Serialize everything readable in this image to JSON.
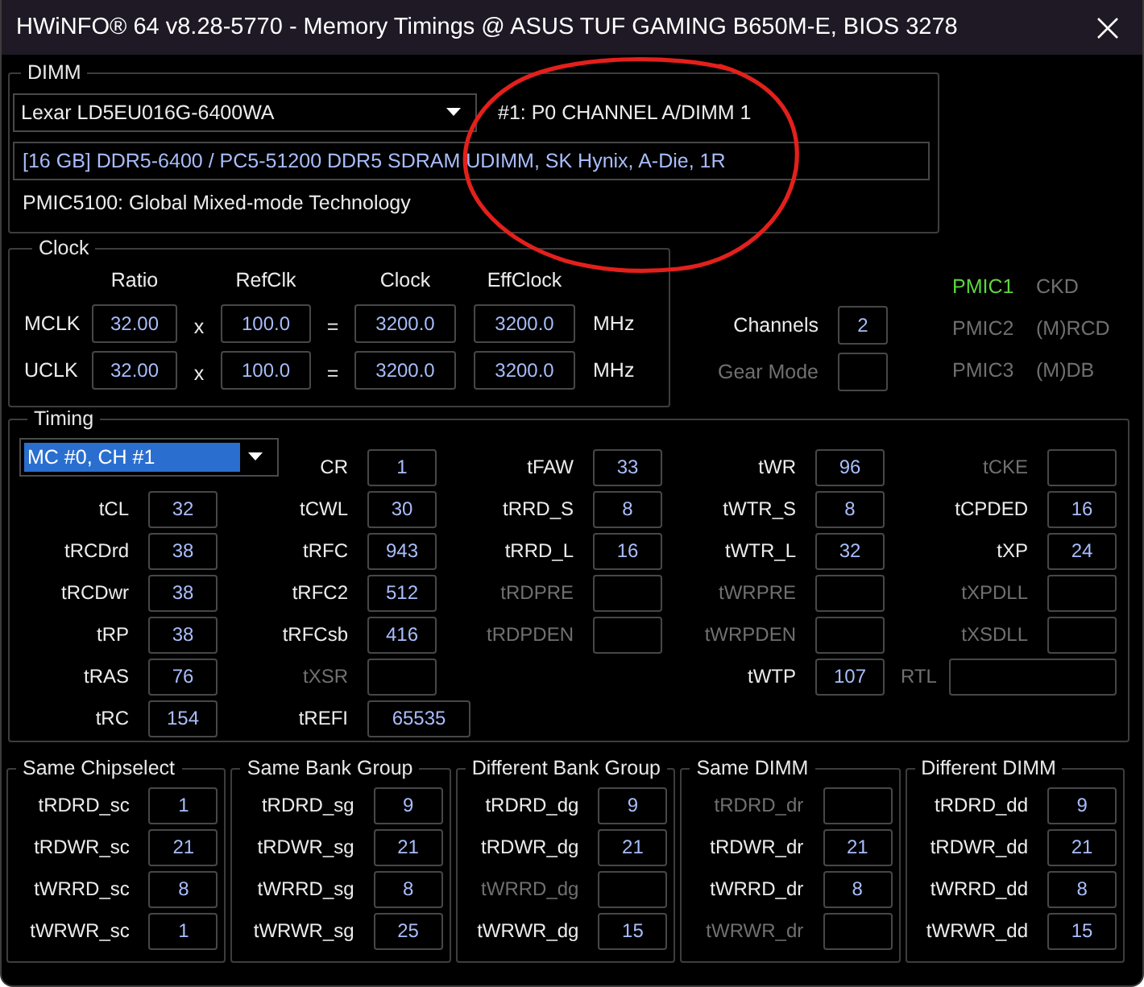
{
  "window": {
    "title": "HWiNFO® 64 v8.28-5770 - Memory Timings @ ASUS TUF GAMING B650M-E, BIOS 3278"
  },
  "dimm": {
    "title": "DIMM",
    "module_select": {
      "value": "Lexar LD5EU016G-6400WA"
    },
    "slot": "#1: P0 CHANNEL A/DIMM 1",
    "description": "[16 GB] DDR5-6400 / PC5-51200 DDR5 SDRAM UDIMM, SK Hynix, A-Die, 1R",
    "pmic": "PMIC5100: Global Mixed-mode Technology"
  },
  "clock": {
    "title": "Clock",
    "columns": [
      "Ratio",
      "RefClk",
      "Clock",
      "EffClock"
    ],
    "rows": [
      {
        "label": "MCLK",
        "ratio": "32.00",
        "times": "x",
        "refclk": "100.0",
        "equals": "=",
        "clock": "3200.0",
        "effclock": "3200.0",
        "unit": "MHz"
      },
      {
        "label": "UCLK",
        "ratio": "32.00",
        "times": "x",
        "refclk": "100.0",
        "equals": "=",
        "clock": "3200.0",
        "effclock": "3200.0",
        "unit": "MHz"
      }
    ]
  },
  "settings": [
    {
      "label": "Channels",
      "value": "2",
      "disabled": false
    },
    {
      "label": "Gear Mode",
      "disabled": true
    }
  ],
  "pmics": [
    {
      "name": "PMIC1",
      "role": "CKD",
      "active": true
    },
    {
      "name": "PMIC2",
      "role": "(M)RCD",
      "active": false
    },
    {
      "name": "PMIC3",
      "role": "(M)DB",
      "active": false
    }
  ],
  "timing": {
    "title": "Timing",
    "channel_select": {
      "value": "MC #0, CH #1",
      "highlighted": true
    },
    "columns": [
      [
        {
          "label": "tCL",
          "value": "32",
          "disabled": false,
          "kind": "standard"
        },
        {
          "label": "tRCDrd",
          "value": "38",
          "disabled": false,
          "kind": "standard"
        },
        {
          "label": "tRCDwr",
          "value": "38",
          "disabled": false,
          "kind": "standard"
        },
        {
          "label": "tRP",
          "value": "38",
          "disabled": false,
          "kind": "standard"
        },
        {
          "label": "tRAS",
          "value": "76",
          "disabled": false,
          "kind": "standard"
        },
        {
          "label": "tRC",
          "value": "154",
          "disabled": false,
          "kind": "standard"
        }
      ],
      [
        {
          "label": "CR",
          "value": "1",
          "disabled": false,
          "kind": "standard"
        },
        {
          "label": "tCWL",
          "value": "30",
          "disabled": false,
          "kind": "standard"
        },
        {
          "label": "tRFC",
          "value": "943",
          "disabled": false,
          "kind": "standard"
        },
        {
          "label": "tRFC2",
          "value": "512",
          "disabled": false,
          "kind": "standard"
        },
        {
          "label": "tRFCsb",
          "value": "416",
          "disabled": false,
          "kind": "standard"
        },
        {
          "label": "tXSR",
          "disabled": true,
          "kind": "standard"
        },
        {
          "label": "tREFI",
          "value": "65535",
          "disabled": false,
          "kind": "wide"
        }
      ],
      [
        {
          "label": "tFAW",
          "value": "33",
          "disabled": false,
          "kind": "standard"
        },
        {
          "label": "tRRD_S",
          "value": "8",
          "disabled": false,
          "kind": "standard"
        },
        {
          "label": "tRRD_L",
          "value": "16",
          "disabled": false,
          "kind": "standard"
        },
        {
          "label": "tRDPRE",
          "disabled": true,
          "kind": "standard"
        },
        {
          "label": "tRDPDEN",
          "disabled": true,
          "kind": "standard"
        }
      ],
      [
        {
          "label": "tWR",
          "value": "96",
          "disabled": false,
          "kind": "standard"
        },
        {
          "label": "tWTR_S",
          "value": "8",
          "disabled": false,
          "kind": "standard"
        },
        {
          "label": "tWTR_L",
          "value": "32",
          "disabled": false,
          "kind": "standard"
        },
        {
          "label": "tWRPRE",
          "disabled": true,
          "kind": "standard"
        },
        {
          "label": "tWRPDEN",
          "disabled": true,
          "kind": "standard"
        },
        {
          "label": "tWTP",
          "value": "107",
          "disabled": false,
          "kind": "standard"
        }
      ],
      [
        {
          "label": "tCKE",
          "disabled": true,
          "kind": "standard"
        },
        {
          "label": "tCPDED",
          "value": "16",
          "disabled": false,
          "kind": "standard"
        },
        {
          "label": "tXP",
          "value": "24",
          "disabled": false,
          "kind": "standard"
        },
        {
          "label": "tXPDLL",
          "disabled": true,
          "kind": "standard"
        },
        {
          "label": "tXSDLL",
          "disabled": true,
          "kind": "standard"
        },
        {
          "label": "RTL",
          "disabled": true,
          "kind": "inline"
        }
      ]
    ]
  },
  "groups": [
    {
      "title": "Same Chipselect",
      "items": [
        {
          "label": "tRDRD_sc",
          "value": "1",
          "disabled": false
        },
        {
          "label": "tRDWR_sc",
          "value": "21",
          "disabled": false
        },
        {
          "label": "tWRRD_sc",
          "value": "8",
          "disabled": false
        },
        {
          "label": "tWRWR_sc",
          "value": "1",
          "disabled": false
        }
      ]
    },
    {
      "title": "Same Bank Group",
      "items": [
        {
          "label": "tRDRD_sg",
          "value": "9",
          "disabled": false
        },
        {
          "label": "tRDWR_sg",
          "value": "21",
          "disabled": false
        },
        {
          "label": "tWRRD_sg",
          "value": "8",
          "disabled": false
        },
        {
          "label": "tWRWR_sg",
          "value": "25",
          "disabled": false
        }
      ]
    },
    {
      "title": "Different Bank Group",
      "items": [
        {
          "label": "tRDRD_dg",
          "value": "9",
          "disabled": false
        },
        {
          "label": "tRDWR_dg",
          "value": "21",
          "disabled": false
        },
        {
          "label": "tWRRD_dg",
          "disabled": true
        },
        {
          "label": "tWRWR_dg",
          "value": "15",
          "disabled": false
        }
      ]
    },
    {
      "title": "Same DIMM",
      "items": [
        {
          "label": "tRDRD_dr",
          "disabled": true
        },
        {
          "label": "tRDWR_dr",
          "value": "21",
          "disabled": false
        },
        {
          "label": "tWRRD_dr",
          "value": "8",
          "disabled": false
        },
        {
          "label": "tWRWR_dr",
          "disabled": true
        }
      ]
    },
    {
      "title": "Different DIMM",
      "items": [
        {
          "label": "tRDRD_dd",
          "value": "9",
          "disabled": false
        },
        {
          "label": "tRDWR_dd",
          "value": "21",
          "disabled": false
        },
        {
          "label": "tWRRD_dd",
          "value": "8",
          "disabled": false
        },
        {
          "label": "tWRWR_dd",
          "value": "15",
          "disabled": false
        }
      ]
    }
  ]
}
